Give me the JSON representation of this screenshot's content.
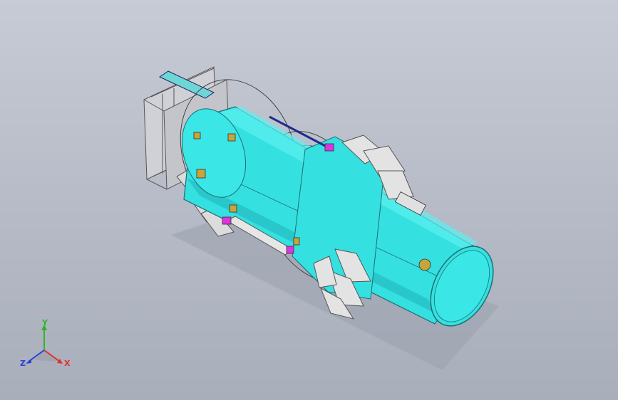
{
  "viewport": {
    "background_top": "#c7cbd5",
    "background_bottom": "#a9aebb"
  },
  "model": {
    "body_color": "#35e0e0",
    "body_edge_color": "#1b6f74",
    "frame_color": "#d9d9d9",
    "pipe_color": "#1c2d8c",
    "accent_colors": [
      "#e033e0",
      "#c9a43a",
      "#3ad4d4"
    ]
  },
  "triad": {
    "x_label": "X",
    "y_label": "Y",
    "z_label": "Z",
    "x_color": "#e03030",
    "y_color": "#2ab82a",
    "z_color": "#2a3fd8"
  }
}
